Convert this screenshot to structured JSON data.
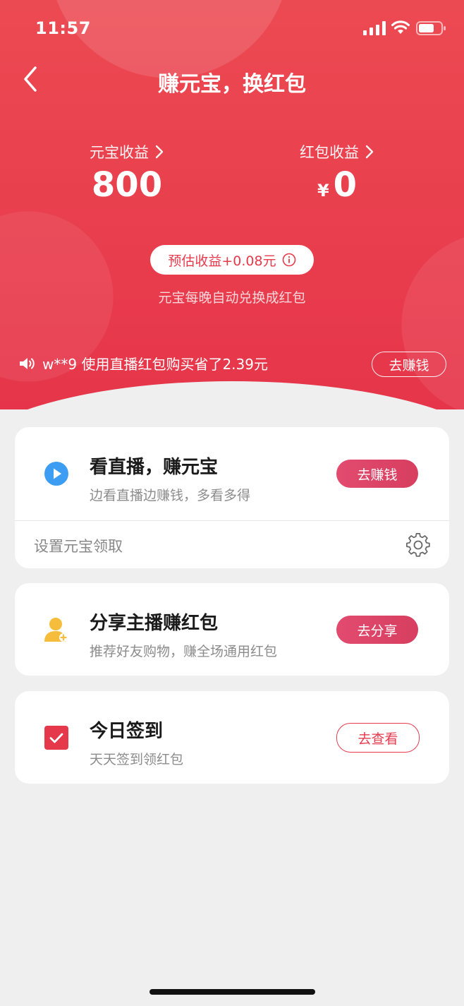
{
  "status_bar": {
    "time": "11:57"
  },
  "header": {
    "title": "赚元宝，换红包",
    "stats": {
      "yuanbao": {
        "label": "元宝收益",
        "value": "800"
      },
      "redpacket": {
        "label": "红包收益",
        "currency": "¥",
        "value": "0"
      }
    },
    "estimate": {
      "label": "预估收益+0.08元"
    },
    "auto_note": "元宝每晚自动兑换成红包",
    "ticker": {
      "text": "w**9 使用直播红包购买省了2.39元",
      "button": "去赚钱"
    }
  },
  "tasks": [
    {
      "title": "看直播，赚元宝",
      "subtitle": "边看直播边赚钱，多看多得",
      "button": "去赚钱",
      "icon": "play-icon",
      "setting_label": "设置元宝领取"
    },
    {
      "title": "分享主播赚红包",
      "subtitle": "推荐好友购物，赚全场通用红包",
      "button": "去分享",
      "icon": "user-add-icon"
    },
    {
      "title": "今日签到",
      "subtitle": "天天签到领红包",
      "button": "去查看",
      "icon": "checkbox-icon"
    }
  ],
  "colors": {
    "header_red": "#e9394b",
    "button_pink": "#dc4466",
    "play_blue": "#3d9df2",
    "user_yellow": "#f5bd3b",
    "check_red": "#e5384b"
  }
}
